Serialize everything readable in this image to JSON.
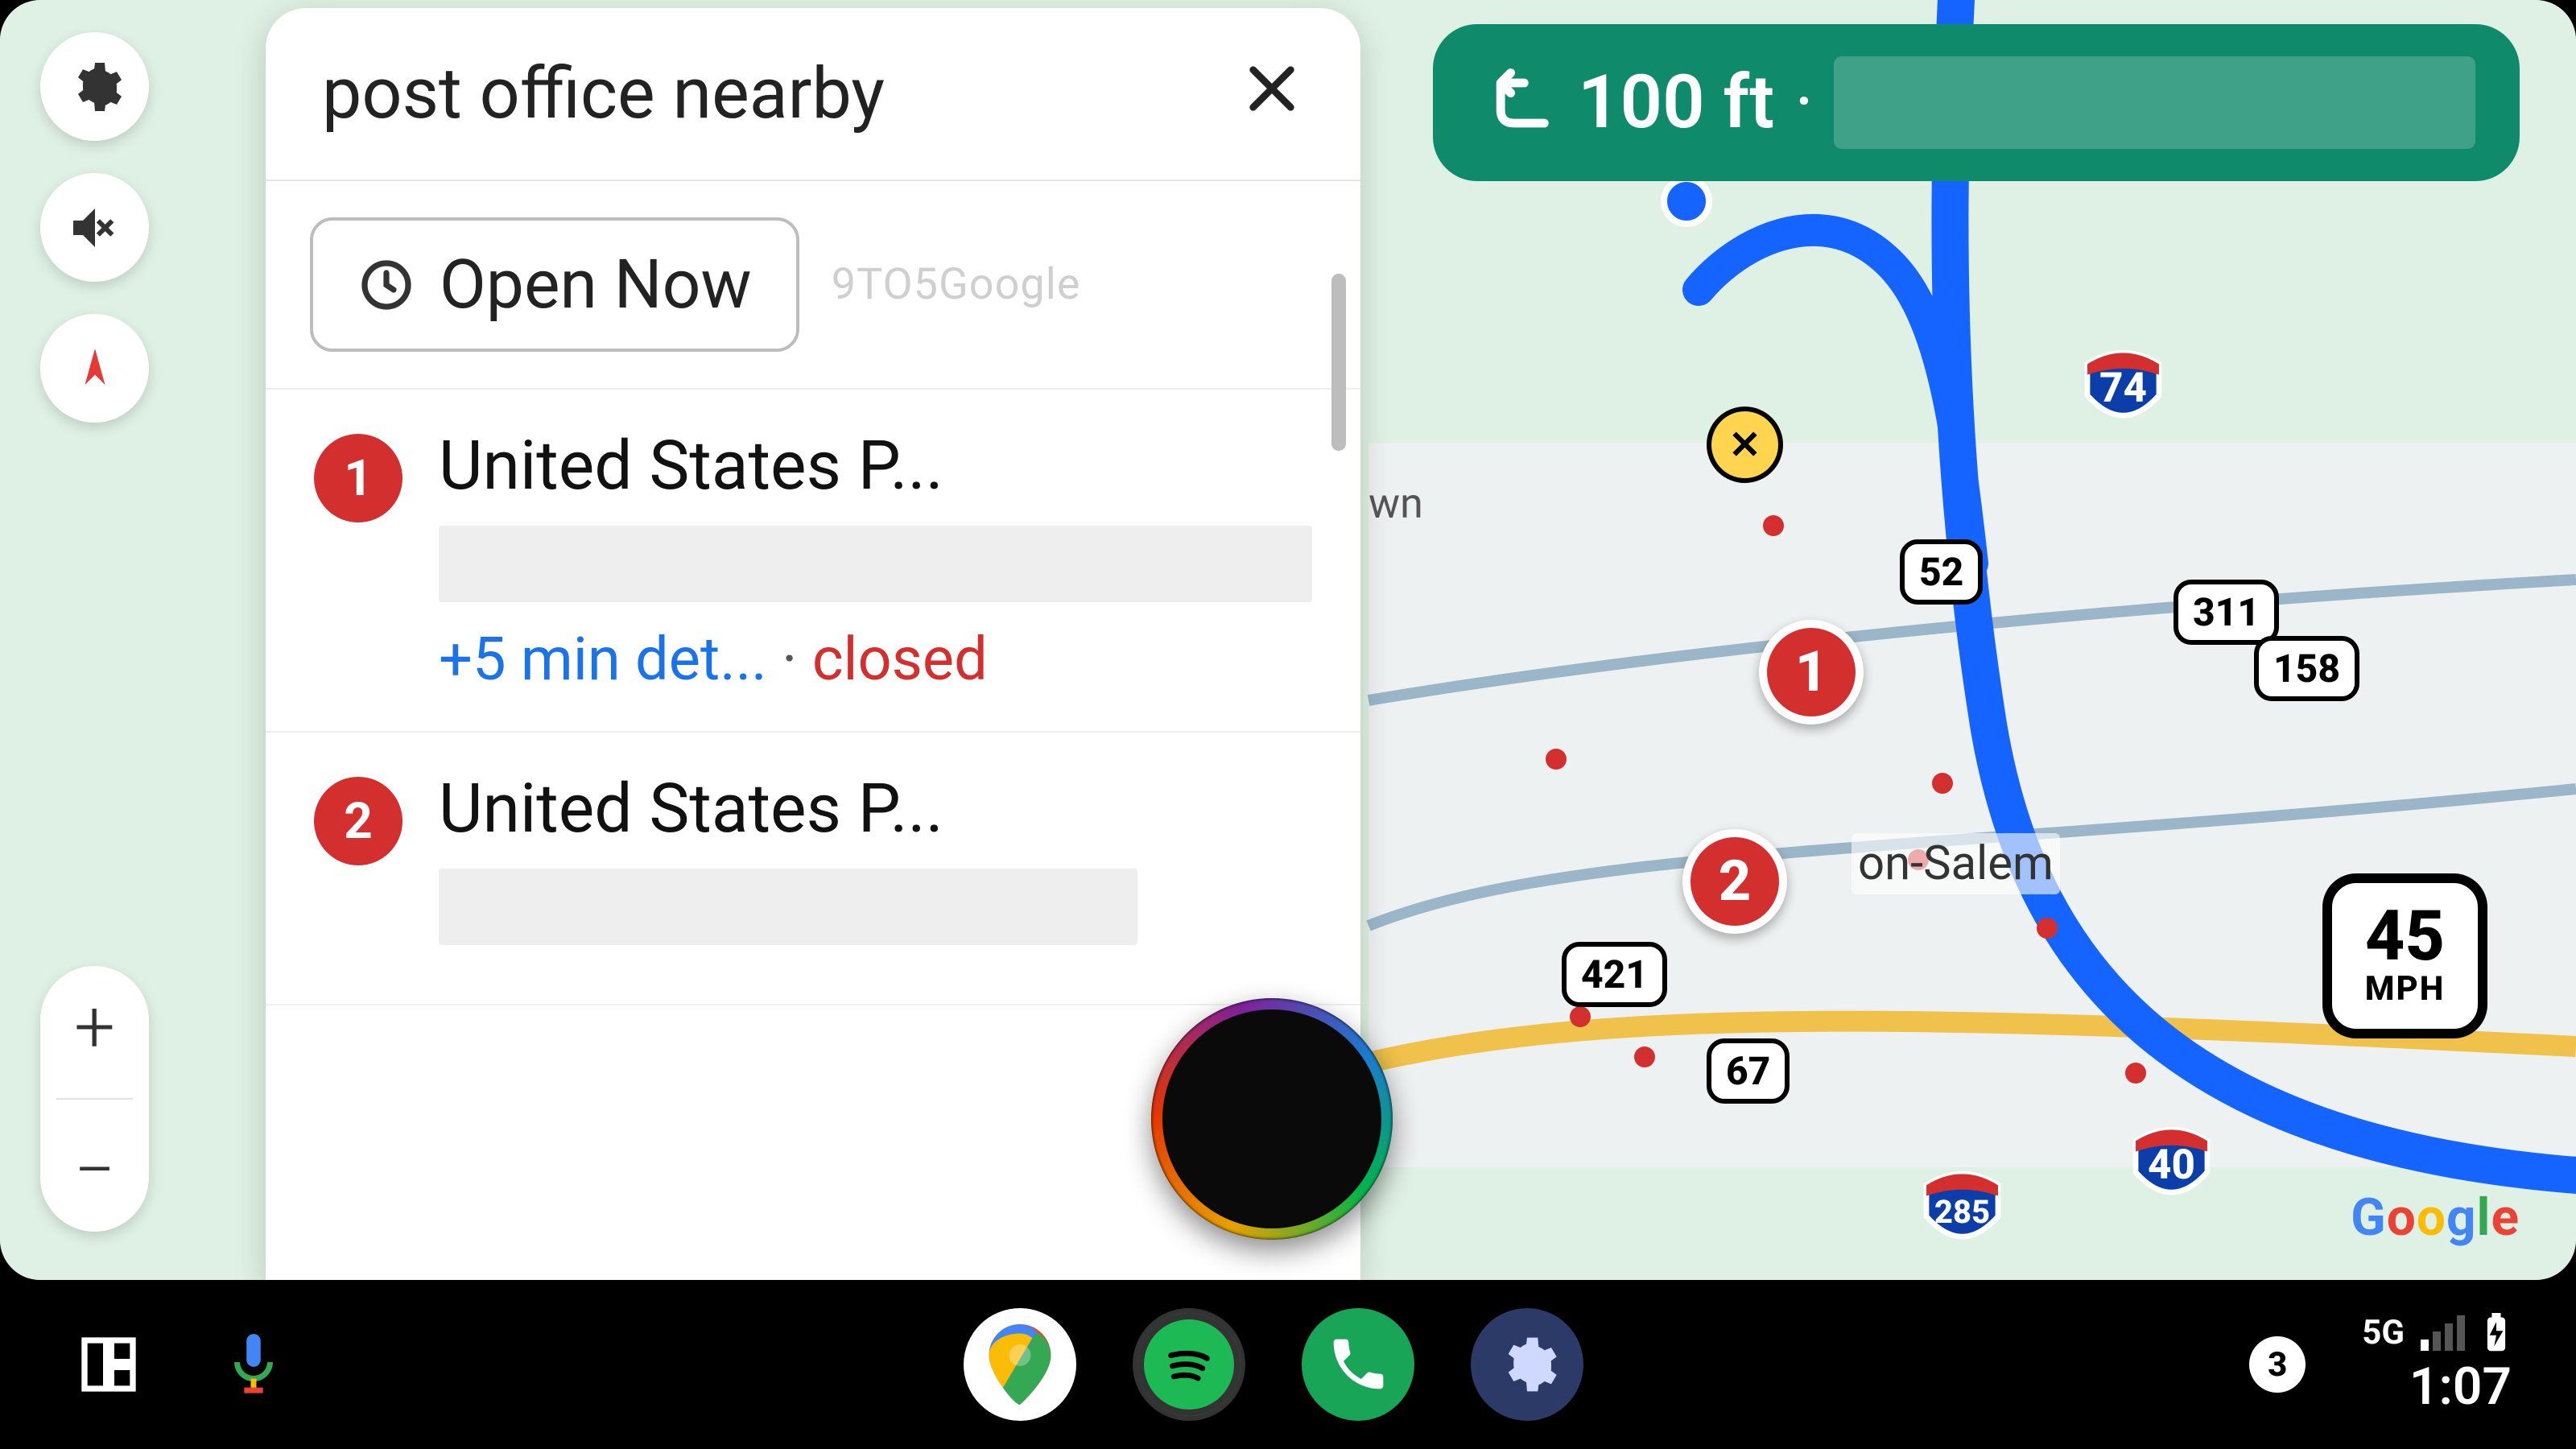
{
  "search": {
    "query": "post office nearby"
  },
  "filters": {
    "open_now_label": "Open Now",
    "watermark": "9TO5Google"
  },
  "results": [
    {
      "index": "1",
      "title": "United States P...",
      "detour": "+5 min det...",
      "dot": " · ",
      "status": "closed"
    },
    {
      "index": "2",
      "title": "United States P...",
      "detour": "",
      "dot": "",
      "status": ""
    }
  ],
  "nav": {
    "distance": "100 ft",
    "sep": "·"
  },
  "speed_limit": {
    "value": "45",
    "unit": "MPH"
  },
  "map": {
    "city": "on-Salem",
    "town_fragment": "wn",
    "interstates": {
      "i74": "74",
      "i40": "40",
      "i285": "285"
    },
    "us_routes": {
      "r52": "52",
      "r311": "311",
      "r158": "158",
      "r421": "421",
      "r67": "67"
    },
    "pins": {
      "p1": "1",
      "p2": "2"
    },
    "attribution": "Google"
  },
  "dock": {
    "notification_count": "3",
    "network": "5G",
    "clock": "1:07"
  }
}
